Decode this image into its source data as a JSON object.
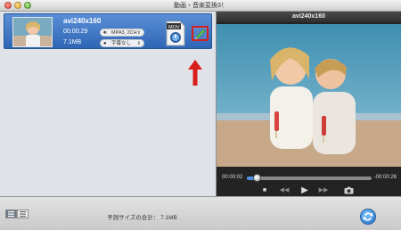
{
  "window": {
    "title": "動画・音楽変換3！"
  },
  "item": {
    "name": "avi240x160",
    "duration": "00:00:29",
    "size": "7.1MB",
    "audio_label": "MPA3, 2CH",
    "subtitle_label": "字幕なし",
    "format_badge": "MOV"
  },
  "preview": {
    "title": "avi240x160",
    "time_current": "00:00:02",
    "time_remaining": "-00:00:26",
    "progress": 0.08
  },
  "controls": {
    "stop_glyph": "■",
    "rewind_glyph": "◀◀",
    "play_glyph": "▶",
    "forward_glyph": "▶▶",
    "snapshot_icon": "camera-icon"
  },
  "footer": {
    "size_label": "予測サイズの合計： 7.1MB"
  },
  "colors": {
    "item_selected": "#3d74c4",
    "highlight_red": "#d91d1d",
    "progress_blue": "#4a8fe0"
  }
}
